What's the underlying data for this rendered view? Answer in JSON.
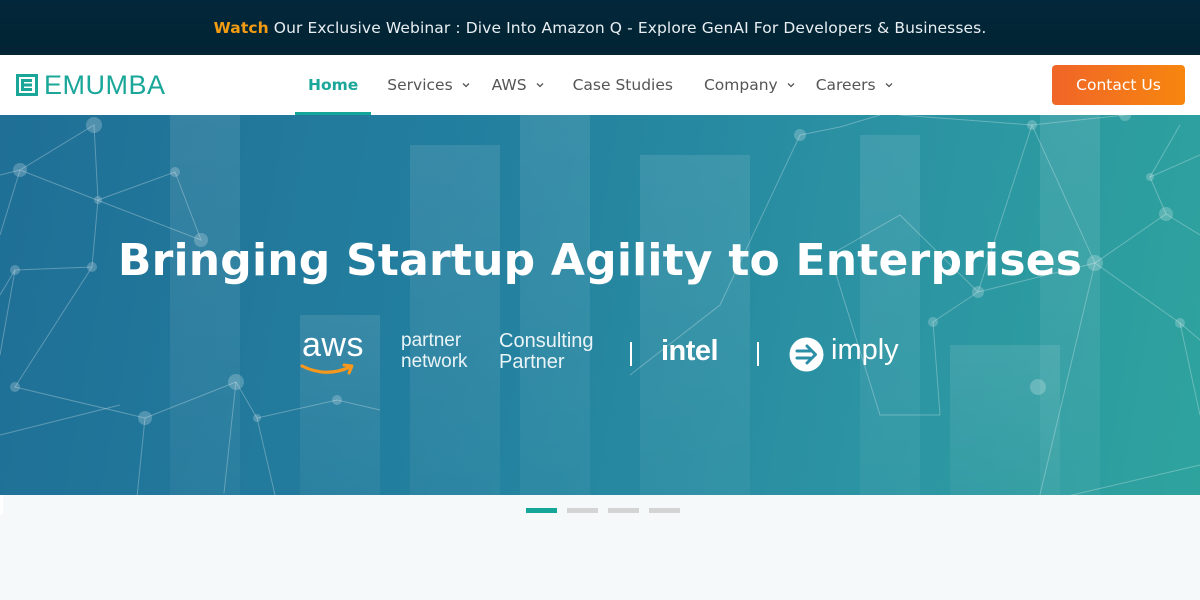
{
  "announcement": {
    "highlight": "Watch",
    "text": "Our Exclusive Webinar : Dive Into Amazon Q - Explore GenAI For Developers & Businesses.",
    "highlight_color": "#f39c12"
  },
  "brand": {
    "name": "EMUMBA",
    "icon": "emumba-logo-icon",
    "color": "#1aa79a"
  },
  "nav": {
    "items": [
      {
        "label": "Home",
        "active": true,
        "dropdown": false
      },
      {
        "label": "Services",
        "active": false,
        "dropdown": true
      },
      {
        "label": "AWS",
        "active": false,
        "dropdown": true
      },
      {
        "label": "Case Studies",
        "active": false,
        "dropdown": false
      },
      {
        "label": "Company",
        "active": false,
        "dropdown": true
      },
      {
        "label": "Careers",
        "active": false,
        "dropdown": true
      }
    ],
    "cta_label": "Contact Us",
    "cta_color": "#f06528"
  },
  "hero": {
    "title": "Bringing Startup Agility to Enterprises",
    "partners": {
      "aws_word": "aws",
      "aws_line1": "partner",
      "aws_line2": "network",
      "aws_tier_line1": "Consulting",
      "aws_tier_line2": "Partner",
      "intel": "intel",
      "imply": "imply"
    }
  },
  "slider": {
    "slide_count": 4,
    "active_index": 0,
    "active_color": "#14a699"
  }
}
